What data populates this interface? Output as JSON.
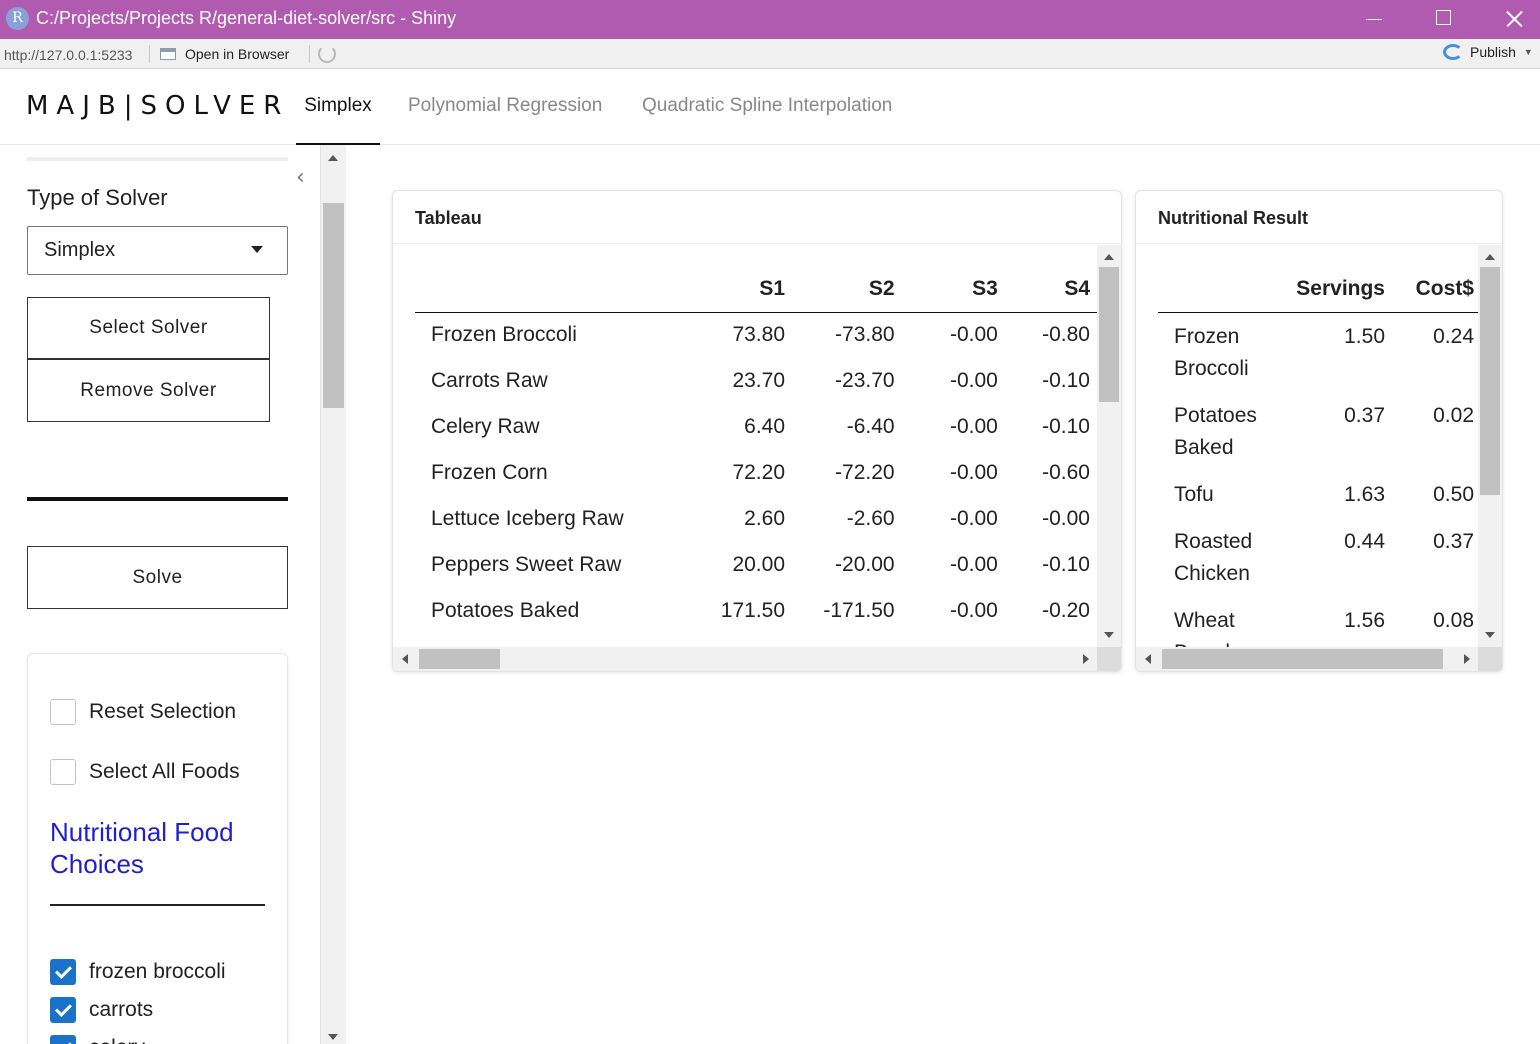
{
  "window": {
    "app_icon_letter": "R",
    "title": "C:/Projects/Projects R/general-diet-solver/src - Shiny"
  },
  "toolbar": {
    "url": "http://127.0.0.1:5233",
    "open_in_browser": "Open in Browser",
    "publish": "Publish"
  },
  "navbar": {
    "brand": "MAJB|SOLVER",
    "tabs": [
      {
        "label": "Simplex",
        "active": true
      },
      {
        "label": "Polynomial Regression",
        "active": false
      },
      {
        "label": "Quadratic Spline Interpolation",
        "active": false
      }
    ]
  },
  "sidebar": {
    "solver_type_label": "Type of Solver",
    "solver_type_value": "Simplex",
    "select_solver_label": "Select Solver",
    "remove_solver_label": "Remove Solver",
    "solve_label": "Solve",
    "reset_selection_label": "Reset Selection",
    "reset_selection_checked": false,
    "select_all_label": "Select All Foods",
    "select_all_checked": false,
    "food_heading": "Nutritional Food Choices",
    "foods": [
      {
        "label": "frozen broccoli",
        "checked": true
      },
      {
        "label": "carrots",
        "checked": true
      },
      {
        "label": "celery",
        "checked": true
      }
    ]
  },
  "tableau": {
    "title": "Tableau",
    "columns": [
      "",
      "S1",
      "S2",
      "S3",
      "S4"
    ],
    "rows": [
      [
        "Frozen Broccoli",
        "73.80",
        "-73.80",
        "-0.00",
        "-0.80"
      ],
      [
        "Carrots Raw",
        "23.70",
        "-23.70",
        "-0.00",
        "-0.10"
      ],
      [
        "Celery Raw",
        "6.40",
        "-6.40",
        "-0.00",
        "-0.10"
      ],
      [
        "Frozen Corn",
        "72.20",
        "-72.20",
        "-0.00",
        "-0.60"
      ],
      [
        "Lettuce Iceberg Raw",
        "2.60",
        "-2.60",
        "-0.00",
        "-0.00"
      ],
      [
        "Peppers Sweet Raw",
        "20.00",
        "-20.00",
        "-0.00",
        "-0.10"
      ],
      [
        "Potatoes Baked",
        "171.50",
        "-171.50",
        "-0.00",
        "-0.20"
      ]
    ]
  },
  "nutritional_result": {
    "title": "Nutritional Result",
    "columns": [
      "",
      "Servings",
      "Cost$"
    ],
    "rows": [
      [
        "Frozen Broccoli",
        "1.50",
        "0.24"
      ],
      [
        "Potatoes Baked",
        "0.37",
        "0.02"
      ],
      [
        "Tofu",
        "1.63",
        "0.50"
      ],
      [
        "Roasted Chicken",
        "0.44",
        "0.37"
      ],
      [
        "Wheat Bread",
        "1.56",
        "0.08"
      ]
    ]
  },
  "colors": {
    "titlebar": "#b15bb0",
    "checkbox_checked": "#1a73c8",
    "food_heading": "#1f1fd0"
  }
}
